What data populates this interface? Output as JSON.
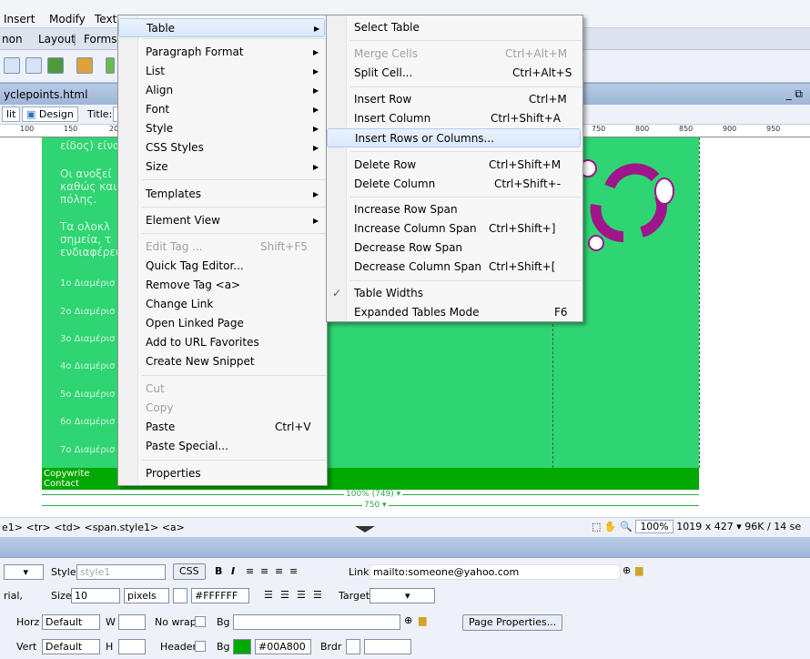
{
  "menubar": {
    "items": [
      "Insert",
      "Modify",
      "Text"
    ]
  },
  "insert_bar": {
    "tabs": [
      "non",
      "Layout",
      "Forms"
    ]
  },
  "document": {
    "filename": "yclepoints.html",
    "window_controls": "_ ⧉",
    "view_split": "lit",
    "view_design": "Design",
    "title_label": "Title:"
  },
  "ruler": {
    "left_ticks": [
      "100",
      "150",
      "20"
    ],
    "right_ticks": [
      "750",
      "800",
      "850",
      "900",
      "950"
    ]
  },
  "canvas": {
    "line1": "είδος) είνα",
    "para1_a": "Οι ανοξεί",
    "para1_b": "καθώς και",
    "para1_c": "πόλης.",
    "para2_a": "Τα ολοκλ",
    "para2_b": "σημεία, τ",
    "para2_c": "ενδιαφέρει",
    "rows": [
      "1ο Διαμέρισ",
      "2ο Διαμέρισ",
      "3ο Διαμέρισ",
      "4ο Διαμέρισ",
      "5ο Διαμέρισ",
      "6ο Διαμέρισ",
      "7ο Διαμέρισ"
    ],
    "footer_copy": "Copywrite",
    "footer_contact": "Contact",
    "width_pct": "100% (749) ▾",
    "width_px": "750 ▾"
  },
  "statusbar": {
    "tags": "e1> <tr> <td> <span.style1> <a>",
    "zoom": "100%",
    "dimensions": "1019 x 427 ▾",
    "size": "96K / 14 se"
  },
  "properties": {
    "style_label": "Style",
    "style_value": "style1",
    "css_button": "CSS",
    "link_label": "Link",
    "link_value": "mailto:someone@yahoo.com",
    "font_value": "rial,",
    "size_label": "Size",
    "size_value": "10",
    "unit_value": "pixels",
    "color_value": "#FFFFFF",
    "target_label": "Target",
    "horz_label": "Horz",
    "horz_value": "Default",
    "w_label": "W",
    "nowrap_label": "No wrap",
    "bg_label": "Bg",
    "page_properties": "Page Properties...",
    "vert_label": "Vert",
    "vert_value": "Default",
    "h_label": "H",
    "header_label": "Header",
    "bg2_label": "Bg",
    "bg_color_value": "#00A800",
    "brdr_label": "Brdr"
  },
  "context_menu": {
    "items": [
      {
        "label": "Table",
        "arrow": "▶"
      },
      {
        "label": "Paragraph Format",
        "arrow": "▶"
      },
      {
        "label": "List",
        "arrow": "▶"
      },
      {
        "label": "Align",
        "arrow": "▶"
      },
      {
        "label": "Font",
        "arrow": "▶"
      },
      {
        "label": "Style",
        "arrow": "▶"
      },
      {
        "label": "CSS Styles",
        "arrow": "▶"
      },
      {
        "label": "Size",
        "arrow": "▶"
      },
      {
        "label": "Templates",
        "arrow": "▶"
      },
      {
        "label": "Element View",
        "arrow": "▶"
      },
      {
        "label": "Edit Tag ...",
        "shortcut": "Shift+F5"
      },
      {
        "label": "Quick Tag Editor..."
      },
      {
        "label": "Remove Tag <a>"
      },
      {
        "label": "Change Link"
      },
      {
        "label": "Open Linked Page"
      },
      {
        "label": "Add to URL Favorites"
      },
      {
        "label": "Create New Snippet"
      },
      {
        "label": "Cut"
      },
      {
        "label": "Copy"
      },
      {
        "label": "Paste",
        "shortcut": "Ctrl+V"
      },
      {
        "label": "Paste Special..."
      },
      {
        "label": "Properties"
      }
    ]
  },
  "table_submenu": {
    "items": [
      {
        "label": "Select Table"
      },
      {
        "label": "Merge Cells",
        "shortcut": "Ctrl+Alt+M"
      },
      {
        "label": "Split Cell...",
        "shortcut": "Ctrl+Alt+S"
      },
      {
        "label": "Insert Row",
        "shortcut": "Ctrl+M"
      },
      {
        "label": "Insert Column",
        "shortcut": "Ctrl+Shift+A"
      },
      {
        "label": "Insert Rows or Columns..."
      },
      {
        "label": "Delete Row",
        "shortcut": "Ctrl+Shift+M"
      },
      {
        "label": "Delete Column",
        "shortcut": "Ctrl+Shift+-"
      },
      {
        "label": "Increase Row Span"
      },
      {
        "label": "Increase Column Span",
        "shortcut": "Ctrl+Shift+]"
      },
      {
        "label": "Decrease Row Span"
      },
      {
        "label": "Decrease Column Span",
        "shortcut": "Ctrl+Shift+["
      },
      {
        "label": "Table Widths",
        "check": "✓"
      },
      {
        "label": "Expanded Tables Mode",
        "shortcut": "F6"
      }
    ]
  },
  "colors": {
    "page_bg": "#2fd572",
    "footer_bg": "#00a800",
    "clipart": "#a0148c"
  }
}
